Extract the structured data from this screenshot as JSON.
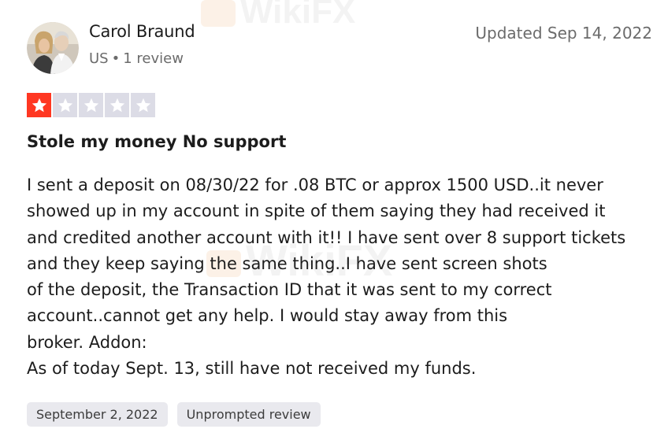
{
  "reviewer": {
    "name": "Carol Braund",
    "country": "US",
    "separator": "•",
    "review_count": "1 review"
  },
  "updated_date": "Updated Sep 14, 2022",
  "rating": {
    "value": 1,
    "max": 5,
    "filled_color": "#ff3722",
    "empty_color": "#dcdce6"
  },
  "review": {
    "title": "Stole my money No support",
    "body_lines": [
      "I sent a deposit on 08/30/22 for .08 BTC or approx 1500 USD..it never",
      "showed up in my account in spite of them saying they had received it",
      "and credited another account with it!! I have sent over 8 support tickets",
      "and they keep saying the same thing..I have sent screen shots",
      "of the deposit, the Transaction ID that it was sent to my correct",
      "account..cannot get any help. I would stay away from this",
      "broker. Addon:",
      "As of today Sept. 13, still have not received my funds."
    ]
  },
  "tags": {
    "experience_date": "September 2, 2022",
    "review_type": "Unprompted review"
  },
  "watermark": {
    "text": "WikiFX"
  },
  "icons": {
    "star": "star-icon",
    "avatar": "user-avatar-photo"
  }
}
